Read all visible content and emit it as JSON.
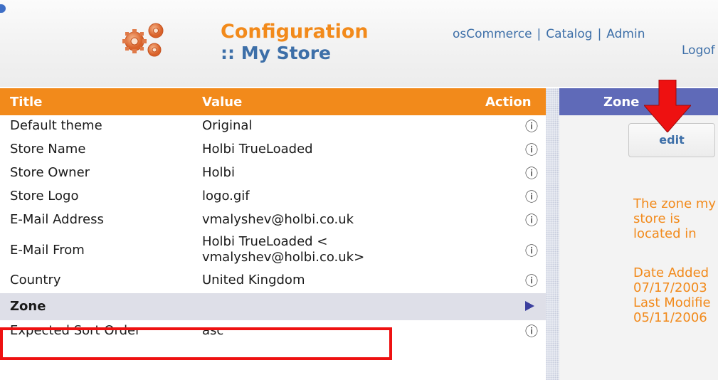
{
  "header": {
    "title_line1": "Configuration",
    "title_line2": ":: My Store",
    "nav": [
      "osCommerce",
      "Catalog",
      "Admin"
    ],
    "nav_sep": "|",
    "logoff": "Logof"
  },
  "table": {
    "headers": {
      "title": "Title",
      "value": "Value",
      "action": "Action"
    },
    "info_icon": "ⓘ",
    "rows": [
      {
        "title": "Default theme",
        "value": "Original"
      },
      {
        "title": "Store Name",
        "value": "Holbi TrueLoaded"
      },
      {
        "title": "Store Owner",
        "value": "Holbi"
      },
      {
        "title": "Store Logo",
        "value": "logo.gif"
      },
      {
        "title": "E-Mail Address",
        "value": "vmalyshev@holbi.co.uk"
      },
      {
        "title": "E-Mail From",
        "value_line1": "Holbi TrueLoaded <",
        "value_line2": "vmalyshev@holbi.co.uk>"
      },
      {
        "title": "Country",
        "value": "United Kingdom"
      },
      {
        "title": "Zone",
        "value": ""
      },
      {
        "title": "Expected Sort Order",
        "value": "asc"
      }
    ]
  },
  "side": {
    "heading": "Zone",
    "edit_label": "edit",
    "description": [
      "The zone my",
      "store is",
      "located in"
    ],
    "date_added_label": "Date Added",
    "date_added": "07/17/2003",
    "last_modified_label": "Last Modifie",
    "last_modified": "05/11/2006"
  },
  "colors": {
    "accent_orange": "#f28a1b",
    "side_header": "#5f6ab8",
    "link_blue": "#3d6fa8",
    "highlight_red": "#ee1111"
  }
}
